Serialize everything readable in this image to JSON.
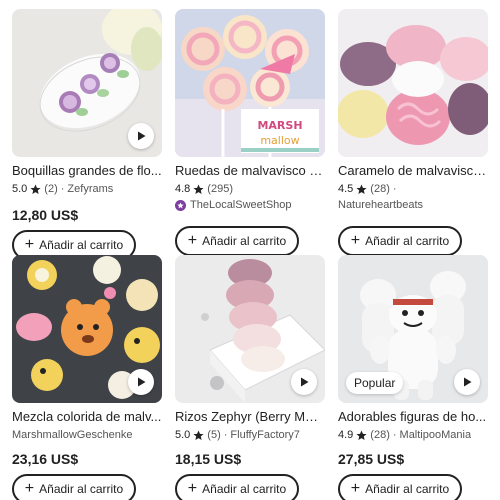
{
  "products": [
    {
      "title": "Boquillas grandes de flo...",
      "rating": "5.0",
      "reviews": "(2)",
      "seller": "Zefyrams",
      "price": "12,80 US$",
      "has_video": true,
      "badge": "",
      "star_seller": false
    },
    {
      "title": "Ruedas de malvavisco - ...",
      "rating": "4.8",
      "reviews": "(295)",
      "seller": "TheLocalSweetShop",
      "price": "",
      "has_video": false,
      "badge": "",
      "star_seller": true,
      "image_text": [
        "MARSH",
        "mallow"
      ]
    },
    {
      "title": "Caramelo de malvavisco...",
      "rating": "4.5",
      "reviews": "(28)",
      "seller": "Natureheartbeats",
      "price": "",
      "has_video": false,
      "badge": "",
      "star_seller": false
    },
    {
      "title": "Mezcla colorida de malv...",
      "rating": "",
      "reviews": "",
      "seller": "MarshmallowGeschenke",
      "price": "23,16 US$",
      "has_video": true,
      "badge": "",
      "star_seller": false
    },
    {
      "title": "Rizos Zephyr (Berry Mars...",
      "rating": "5.0",
      "reviews": "(5)",
      "seller": "FluffyFactory7",
      "price": "18,15 US$",
      "has_video": true,
      "badge": "",
      "star_seller": false
    },
    {
      "title": "Adorables figuras de ho...",
      "rating": "4.9",
      "reviews": "(28)",
      "seller": "MaltipooMania",
      "price": "27,85 US$",
      "has_video": true,
      "badge": "Popular",
      "star_seller": false
    }
  ],
  "add_to_cart_label": "Añadir al carrito",
  "dot_separator": "·",
  "colors": {
    "text": "#222222",
    "star_seller": "#7b3fa0"
  },
  "icons": {
    "video": "play-icon",
    "rating": "star-icon",
    "cart": "plus-icon"
  }
}
